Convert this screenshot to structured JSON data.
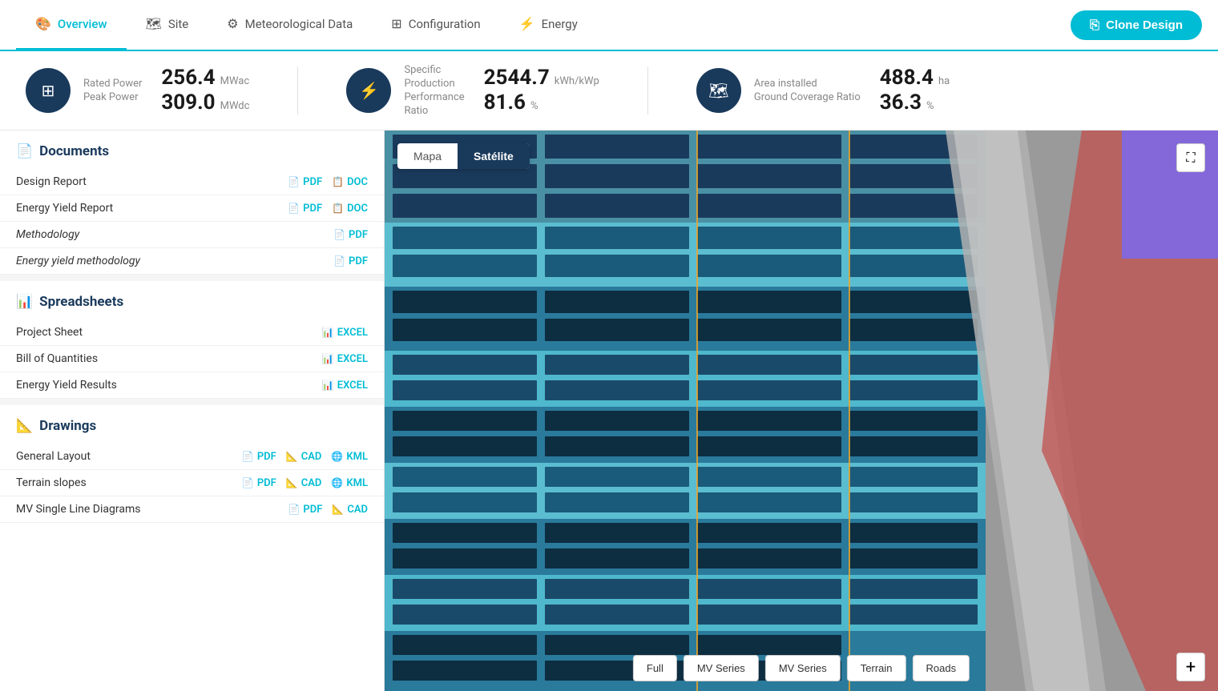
{
  "nav": {
    "tabs": [
      {
        "id": "overview",
        "label": "Overview",
        "icon": "🎨",
        "active": true
      },
      {
        "id": "site",
        "label": "Site",
        "icon": "🗺"
      },
      {
        "id": "meteorological",
        "label": "Meteorological Data",
        "icon": "⚙"
      },
      {
        "id": "configuration",
        "label": "Configuration",
        "icon": "⊞"
      },
      {
        "id": "energy",
        "label": "Energy",
        "icon": "⚡"
      }
    ],
    "clone_button": "Clone Design"
  },
  "stats": [
    {
      "icon": "⊞",
      "labels": [
        "Rated Power",
        "Peak Power"
      ],
      "values": [
        "256.4",
        "309.0"
      ],
      "units": [
        "MWac",
        "MWdc"
      ]
    },
    {
      "icon": "⚡",
      "labels": [
        "Specific Production",
        "Performance Ratio"
      ],
      "values": [
        "2544.7",
        "81.6"
      ],
      "units": [
        "kWh/kWp",
        "%"
      ]
    },
    {
      "icon": "🗺",
      "labels": [
        "Area installed",
        "Ground Coverage Ratio"
      ],
      "values": [
        "488.4",
        "36.3"
      ],
      "units": [
        "ha",
        "%"
      ]
    }
  ],
  "sidebar": {
    "documents": {
      "title": "Documents",
      "rows": [
        {
          "name": "Design Report",
          "links": [
            {
              "type": "PDF",
              "label": "PDF"
            },
            {
              "type": "DOC",
              "label": "DOC"
            }
          ]
        },
        {
          "name": "Energy Yield Report",
          "links": [
            {
              "type": "PDF",
              "label": "PDF"
            },
            {
              "type": "DOC",
              "label": "DOC"
            }
          ]
        },
        {
          "name": "Methodology",
          "italic": true,
          "links": [
            {
              "type": "PDF",
              "label": "PDF"
            }
          ]
        },
        {
          "name": "Energy yield methodology",
          "italic": true,
          "links": [
            {
              "type": "PDF",
              "label": "PDF"
            }
          ]
        }
      ]
    },
    "spreadsheets": {
      "title": "Spreadsheets",
      "rows": [
        {
          "name": "Project Sheet",
          "links": [
            {
              "type": "EXCEL",
              "label": "EXCEL"
            }
          ]
        },
        {
          "name": "Bill of Quantities",
          "links": [
            {
              "type": "EXCEL",
              "label": "EXCEL"
            }
          ]
        },
        {
          "name": "Energy Yield Results",
          "links": [
            {
              "type": "EXCEL",
              "label": "EXCEL"
            }
          ]
        }
      ]
    },
    "drawings": {
      "title": "Drawings",
      "rows": [
        {
          "name": "General Layout",
          "links": [
            {
              "type": "PDF",
              "label": "PDF"
            },
            {
              "type": "CAD",
              "label": "CAD"
            },
            {
              "type": "KML",
              "label": "KML"
            }
          ]
        },
        {
          "name": "Terrain slopes",
          "links": [
            {
              "type": "PDF",
              "label": "PDF"
            },
            {
              "type": "CAD",
              "label": "CAD"
            },
            {
              "type": "KML",
              "label": "KML"
            }
          ]
        },
        {
          "name": "MV Single Line Diagrams",
          "links": [
            {
              "type": "PDF",
              "label": "PDF"
            },
            {
              "type": "CAD",
              "label": "CAD"
            }
          ]
        }
      ]
    }
  },
  "map": {
    "toggle": {
      "options": [
        "Mapa",
        "Satélite"
      ],
      "active": "Satélite"
    },
    "bottom_controls": [
      "Full",
      "MV Series",
      "MV Series ",
      "Terrain",
      "Roads"
    ],
    "zoom_plus": "+"
  }
}
